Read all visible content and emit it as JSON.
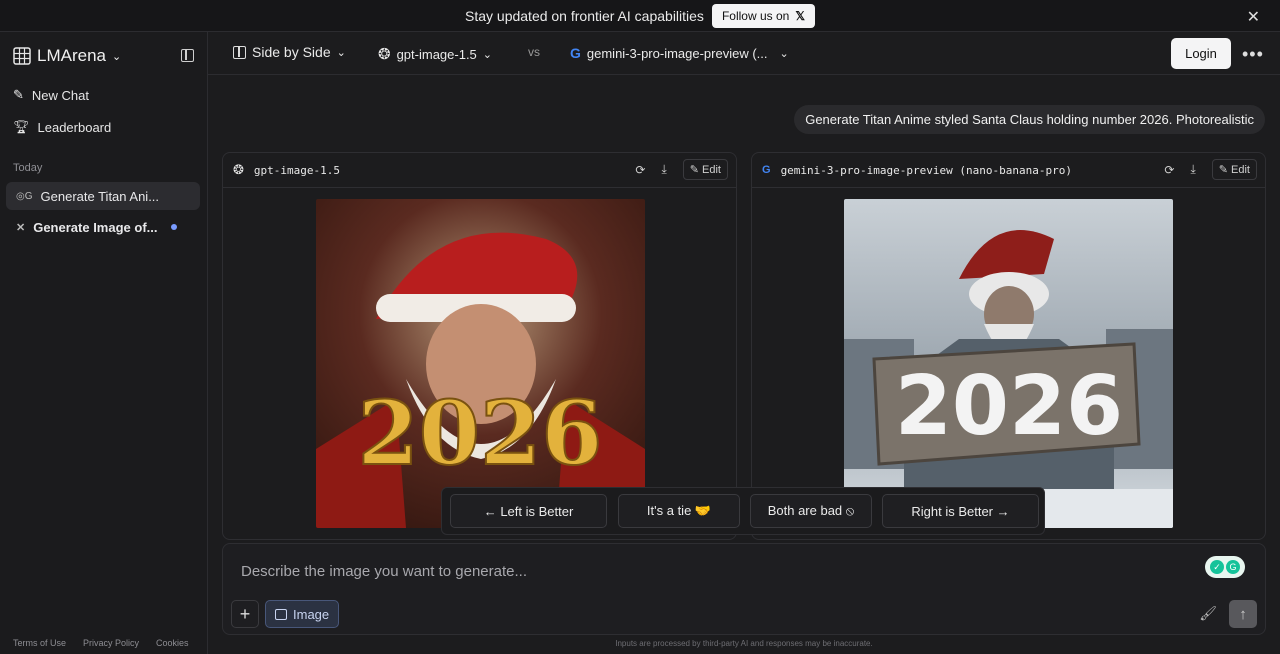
{
  "banner": {
    "text": "Stay updated on frontier AI capabilities",
    "follow_label": "Follow us on",
    "x_icon": "x-logo-icon",
    "close_icon": "close-icon"
  },
  "sidebar": {
    "brand": "LMArena",
    "new_chat": "New Chat",
    "leaderboard": "Leaderboard",
    "section_today": "Today",
    "history": [
      {
        "label": "Generate Titan Ani...",
        "active": true
      },
      {
        "label": "Generate Image of...",
        "active": false,
        "unread": true
      }
    ],
    "footer": {
      "terms": "Terms of Use",
      "privacy": "Privacy Policy",
      "cookies": "Cookies"
    }
  },
  "topbar": {
    "mode": "Side by Side",
    "model_a": "gpt-image-1.5",
    "vs": "vs",
    "model_b": "gemini-3-pro-image-preview (...",
    "login": "Login"
  },
  "prompt": "Generate Titan Anime styled Santa Claus holding number 2026. Photorealistic",
  "cards": [
    {
      "model": "gpt-image-1.5",
      "edit": "Edit",
      "image_text": "2026"
    },
    {
      "model": "gemini-3-pro-image-preview (nano-banana-pro)",
      "edit": "Edit",
      "image_text": "2026"
    }
  ],
  "vote": {
    "left": "← Left is Better",
    "tie": "It's a tie 🤝",
    "bad": "Both are bad ⦸",
    "right": "Right is Better →"
  },
  "composer": {
    "placeholder": "Describe the image you want to generate...",
    "plus": "+",
    "image_label": "Image",
    "disclaimer": "Inputs are processed by third-party AI and responses may be inaccurate."
  }
}
